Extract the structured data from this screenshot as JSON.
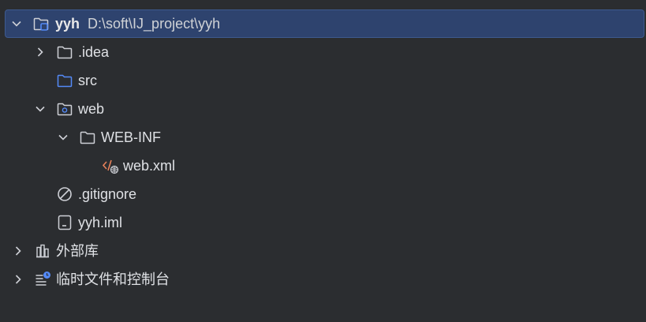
{
  "tree": {
    "root": {
      "name": "yyh",
      "path": "D:\\soft\\IJ_project\\yyh",
      "expanded": true,
      "icon": "project-folder-icon"
    },
    "items": [
      {
        "label": ".idea",
        "icon": "folder-icon",
        "expanded": false
      },
      {
        "label": "src",
        "icon": "source-folder-icon"
      },
      {
        "label": "web",
        "icon": "web-folder-icon",
        "expanded": true
      },
      {
        "label": "WEB-INF",
        "icon": "folder-icon",
        "expanded": true
      },
      {
        "label": "web.xml",
        "icon": "xml-file-icon"
      },
      {
        "label": ".gitignore",
        "icon": "ignore-file-icon"
      },
      {
        "label": "yyh.iml",
        "icon": "iml-file-icon"
      },
      {
        "label": "外部库",
        "icon": "external-libraries-icon",
        "expanded": false
      },
      {
        "label": "临时文件和控制台",
        "icon": "scratches-icon",
        "expanded": false
      }
    ]
  },
  "colors": {
    "background": "#2b2d30",
    "selection": "#2e436e",
    "folder_outline": "#ced0d6",
    "source_folder": "#548af7",
    "xml_accent": "#e5805a"
  }
}
